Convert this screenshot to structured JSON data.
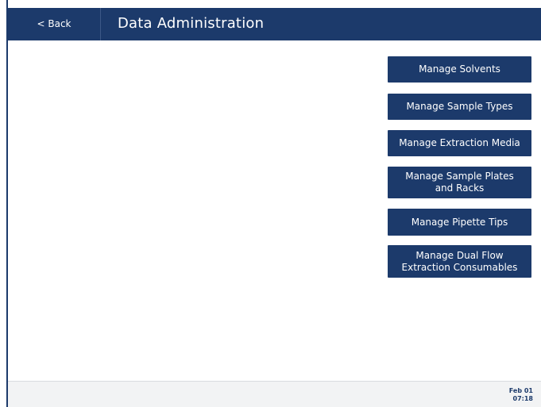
{
  "header": {
    "back_label": "< Back",
    "title": "Data Administration"
  },
  "actions": [
    {
      "label": "Manage Solvents"
    },
    {
      "label": "Manage Sample Types"
    },
    {
      "label": "Manage Extraction Media"
    },
    {
      "label": "Manage Sample Plates\nand Racks"
    },
    {
      "label": "Manage Pipette Tips"
    },
    {
      "label": "Manage Dual Flow\nExtraction Consumables"
    }
  ],
  "status": {
    "date": "Feb 01",
    "time": "07:18"
  },
  "colors": {
    "brand_navy": "#1c3a6b",
    "footer_bg": "#f2f3f4",
    "text_on_brand": "#ffffff"
  }
}
